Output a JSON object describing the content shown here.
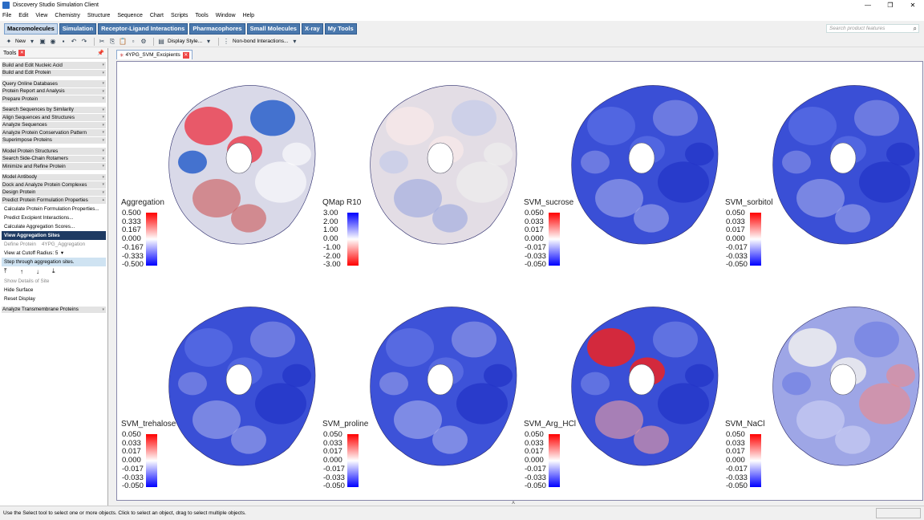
{
  "window": {
    "title": "Discovery Studio Simulation Client"
  },
  "menu": [
    "File",
    "Edit",
    "View",
    "Chemistry",
    "Structure",
    "Sequence",
    "Chart",
    "Scripts",
    "Tools",
    "Window",
    "Help"
  ],
  "categories": [
    "Macromolecules",
    "Simulation",
    "Receptor-Ligand Interactions",
    "Pharmacophores",
    "Small Molecules",
    "X-ray",
    "My Tools"
  ],
  "search": {
    "placeholder": "Search product features"
  },
  "toolbar": {
    "new_label": "New",
    "display_style": "Display Style...",
    "nonbond": "Non-bond Interactions..."
  },
  "tools": {
    "title": "Tools",
    "groups_a": [
      "Build and Edit Nucleic Acid",
      "Build and Edit Protein"
    ],
    "groups_b": [
      "Query Online Databases",
      "Protein Report and Analysis",
      "Prepare Protein"
    ],
    "groups_c": [
      "Search Sequences by Similarity",
      "Align Sequences and Structures",
      "Analyze Sequences",
      "Analyze Protein Conservation Pattern",
      "Superimpose Proteins"
    ],
    "groups_d": [
      "Model Protein Structures",
      "Search Side-Chain Rotamers",
      "Minimize and Refine Protein"
    ],
    "groups_e": [
      "Model Antibody",
      "Dock and Analyze Protein Complexes",
      "Design Protein",
      "Predict Protein Formulation Properties"
    ],
    "sub_items": [
      "Calculate Protein Formulation Properties...",
      "Predict Excipient Interactions...",
      "Calculate Aggregation Scores..."
    ],
    "selected": "View Aggregation Sites",
    "define_protein_label": "Define Protein",
    "define_protein_value": "4YPG_Aggregation",
    "cutoff": "View at Cutoff Radius: 5",
    "step_hint": "Step through aggregation sites.",
    "show_details": "Show Details of Site",
    "hide_surface": "Hide Surface",
    "reset_display": "Reset Display",
    "last_group": "Analyze Transmembrane Proteins"
  },
  "document_tab": "4YPG_SVM_Excipients",
  "panels": [
    {
      "label": "Aggregation",
      "ticks": [
        "0.500",
        "0.333",
        "0.167",
        "0.000",
        "-0.167",
        "-0.333",
        "-0.500"
      ],
      "scale": "rw-b"
    },
    {
      "label": "QMap R10",
      "ticks": [
        "3.00",
        "2.00",
        "1.00",
        "0.00",
        "-1.00",
        "-2.00",
        "-3.00"
      ],
      "scale": "bw-r"
    },
    {
      "label": "SVM_sucrose",
      "ticks": [
        "0.050",
        "0.033",
        "0.017",
        "0.000",
        "-0.017",
        "-0.033",
        "-0.050"
      ],
      "scale": "rw-b"
    },
    {
      "label": "SVM_sorbitol",
      "ticks": [
        "0.050",
        "0.033",
        "0.017",
        "0.000",
        "-0.017",
        "-0.033",
        "-0.050"
      ],
      "scale": "rw-b"
    },
    {
      "label": "SVM_trehalose",
      "ticks": [
        "0.050",
        "0.033",
        "0.017",
        "0.000",
        "-0.017",
        "-0.033",
        "-0.050"
      ],
      "scale": "rw-b"
    },
    {
      "label": "SVM_proline",
      "ticks": [
        "0.050",
        "0.033",
        "0.017",
        "0.000",
        "-0.017",
        "-0.033",
        "-0.050"
      ],
      "scale": "rw-b"
    },
    {
      "label": "SVM_Arg_HCl",
      "ticks": [
        "0.050",
        "0.033",
        "0.017",
        "0.000",
        "-0.017",
        "-0.033",
        "-0.050"
      ],
      "scale": "rw-b"
    },
    {
      "label": "SVM_NaCl",
      "ticks": [
        "0.050",
        "0.033",
        "0.017",
        "0.000",
        "-0.017",
        "-0.033",
        "-0.050"
      ],
      "scale": "rw-b"
    }
  ],
  "status": "Use the Select tool to select one or more objects. Click to select an object, drag to select multiple objects."
}
